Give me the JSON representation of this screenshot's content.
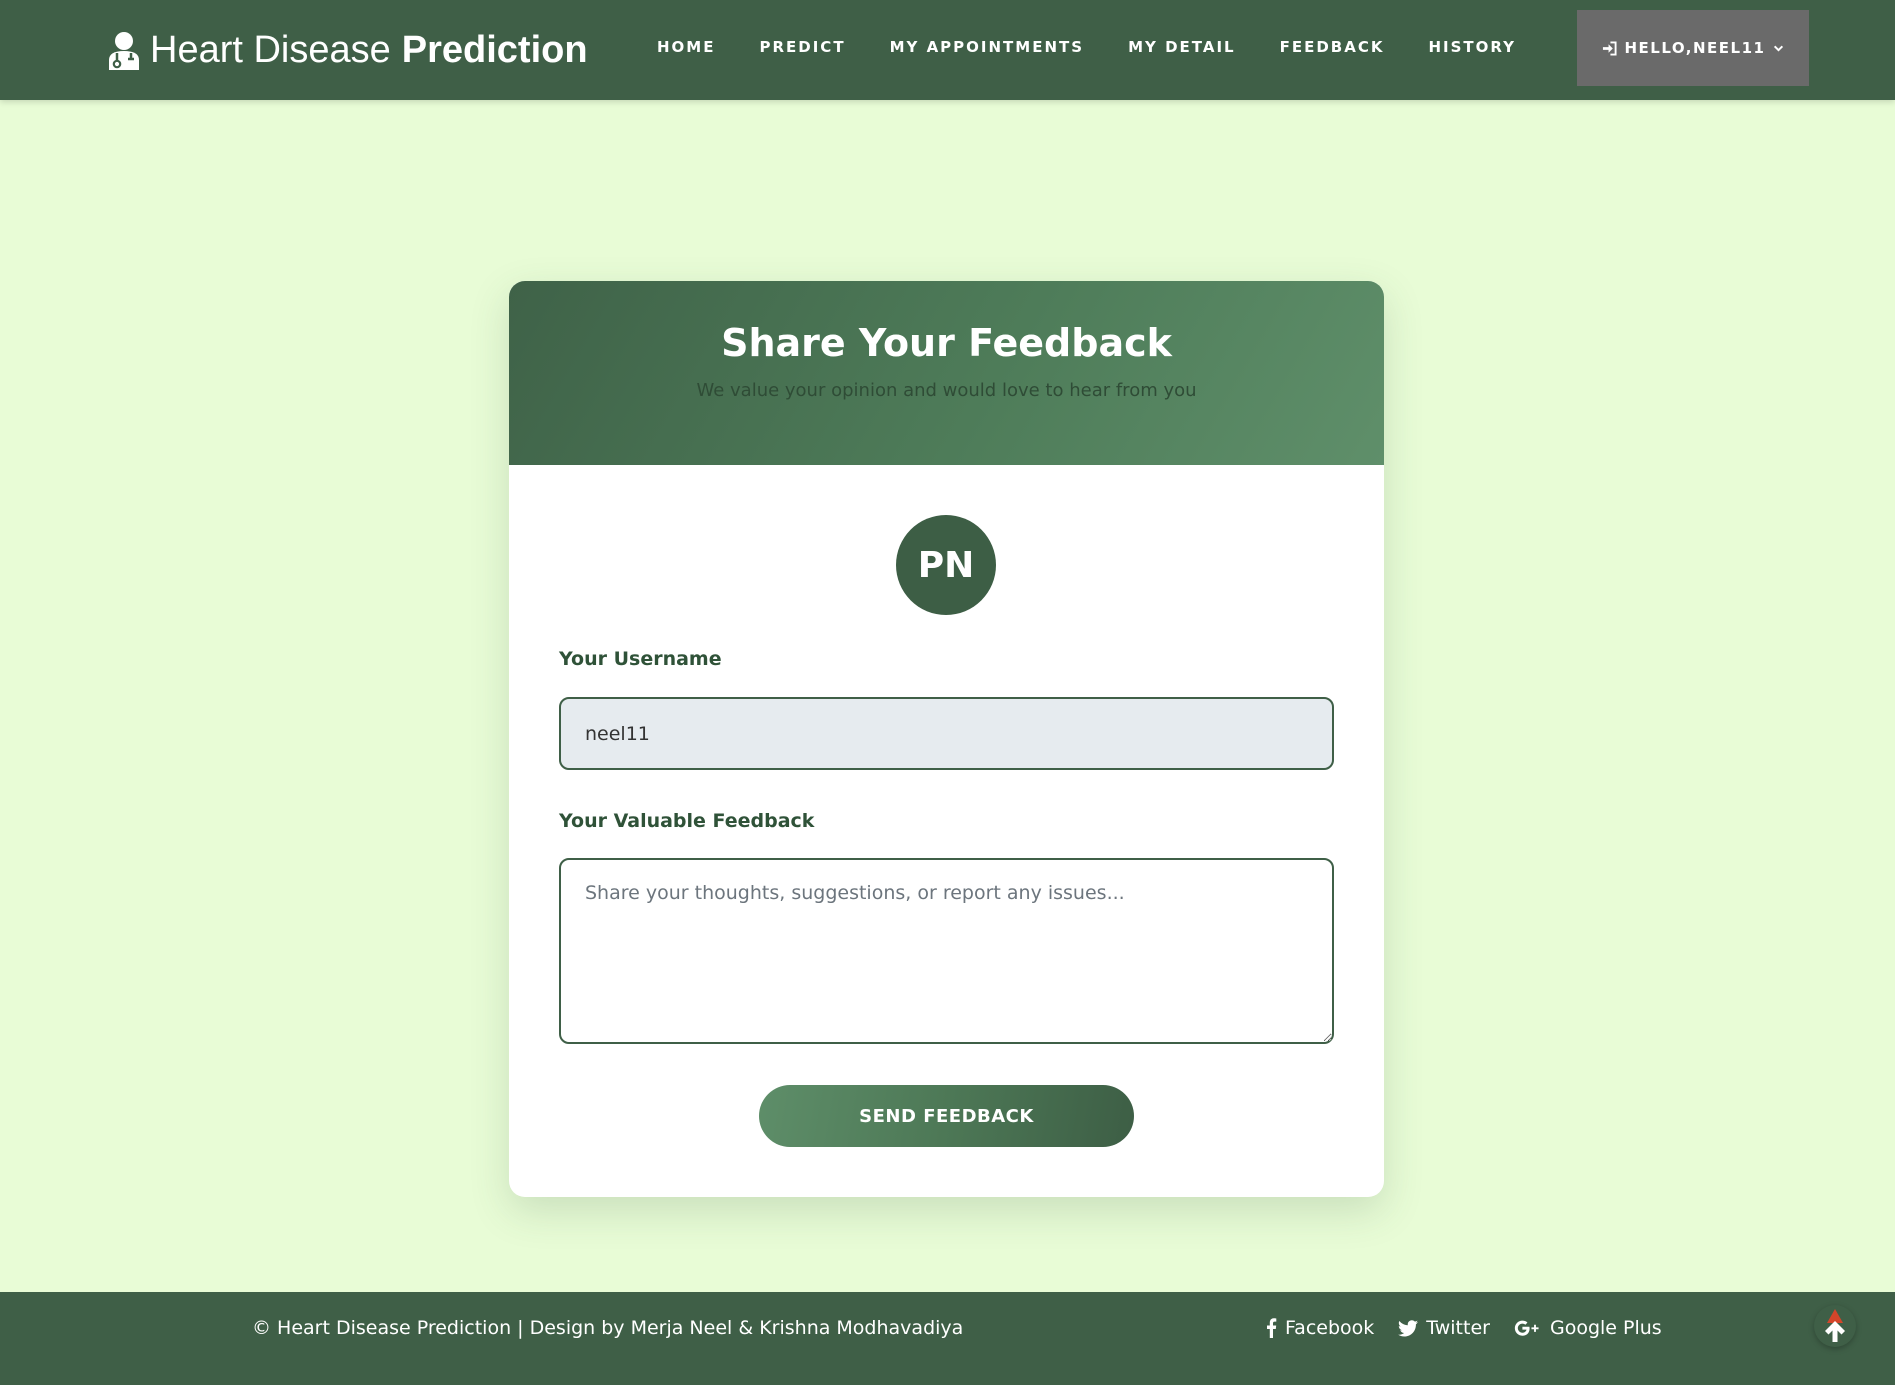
{
  "navbar": {
    "brand_light": "Heart Disease",
    "brand_bold": "Prediction",
    "brand_icon": "doctor-icon",
    "links": [
      {
        "label": "HOME"
      },
      {
        "label": "PREDICT"
      },
      {
        "label": "MY APPOINTMENTS"
      },
      {
        "label": "MY DETAIL"
      },
      {
        "label": "FEEDBACK"
      },
      {
        "label": "HISTORY"
      }
    ],
    "user_menu": {
      "label": "HELLO,NEEL11",
      "icon": "sign-in-icon"
    }
  },
  "card": {
    "title": "Share Your Feedback",
    "subtitle": "We value your opinion and would love to hear from you",
    "avatar_initials": "PN",
    "username_label": "Your Username",
    "username_value": "neel11",
    "feedback_label": "Your Valuable Feedback",
    "feedback_placeholder": "Share your thoughts, suggestions, or report any issues...",
    "submit_label": "Send Feedback"
  },
  "footer": {
    "copyright": "© Heart Disease Prediction | Design by Merja Neel & Krishna Modhavadiya",
    "socials": [
      {
        "label": "Facebook",
        "icon": "facebook-icon"
      },
      {
        "label": "Twitter",
        "icon": "twitter-icon"
      },
      {
        "label": "Google Plus",
        "icon": "google-plus-icon"
      }
    ]
  },
  "colors": {
    "page_bg": "#e8fcd6",
    "primary": "#3f5f47",
    "user_menu_bg": "#6a6a6a"
  }
}
